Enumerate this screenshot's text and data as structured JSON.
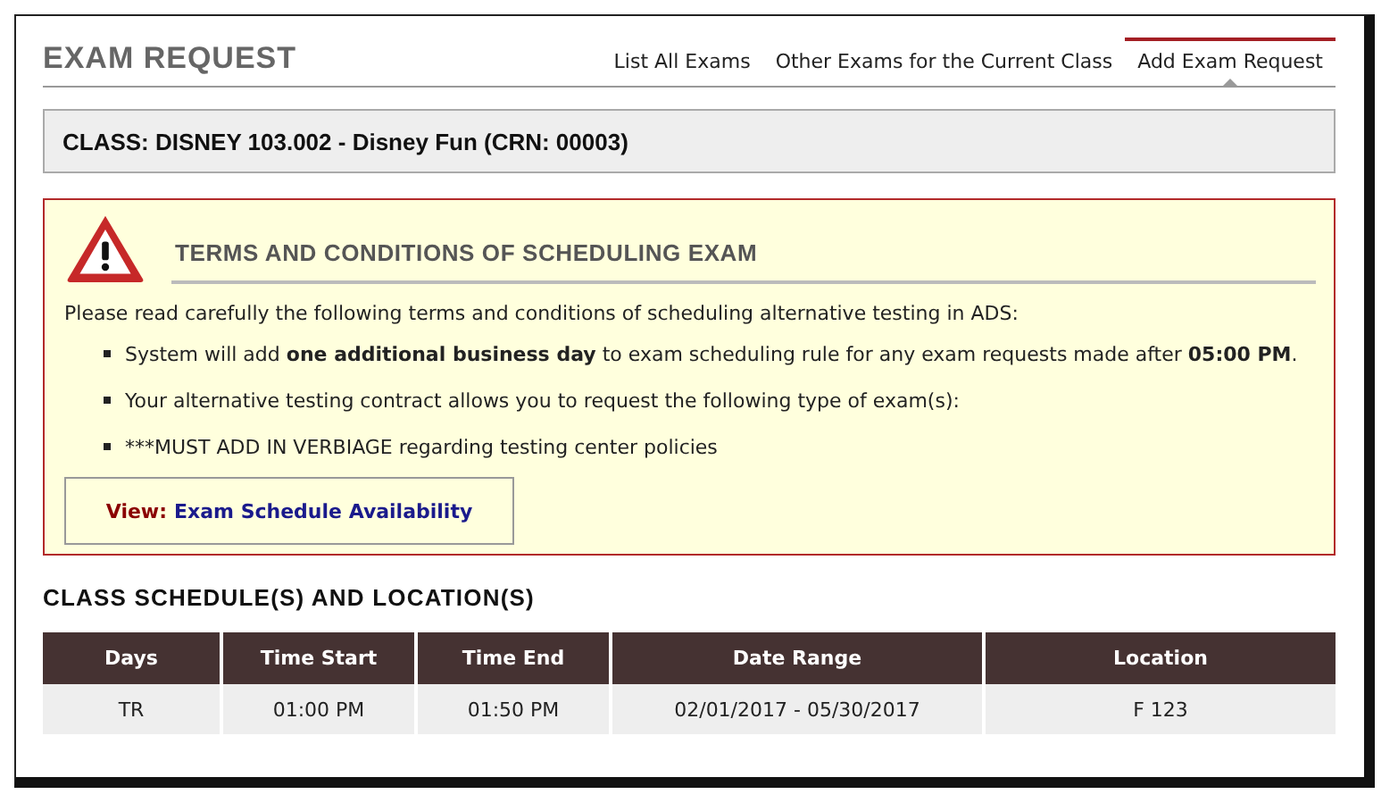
{
  "header": {
    "title": "EXAM REQUEST",
    "tabs": [
      {
        "label": "List All Exams",
        "selected": false
      },
      {
        "label": "Other Exams for the Current Class",
        "selected": false
      },
      {
        "label": "Add Exam Request",
        "selected": true
      }
    ]
  },
  "class_bar": {
    "text": "CLASS: DISNEY 103.002 - Disney Fun (CRN: 00003)"
  },
  "terms": {
    "title": "TERMS AND CONDITIONS OF SCHEDULING EXAM",
    "intro": "Please read carefully the following terms and conditions of scheduling alternative testing in ADS:",
    "items": [
      "System will add **one additional business day** to exam scheduling rule for any exam requests made after **05:00 PM**.",
      "Your alternative testing contract allows you to request the following type of exam(s):",
      "***MUST ADD IN VERBIAGE regarding testing center policies"
    ],
    "view_label": "View:",
    "view_link": "Exam Schedule Availability"
  },
  "schedule": {
    "title": "CLASS SCHEDULE(S) AND LOCATION(S)",
    "columns": [
      "Days",
      "Time Start",
      "Time End",
      "Date Range",
      "Location"
    ],
    "rows": [
      [
        "TR",
        "01:00 PM",
        "01:50 PM",
        "02/01/2017 - 05/30/2017",
        "F 123"
      ]
    ]
  }
}
